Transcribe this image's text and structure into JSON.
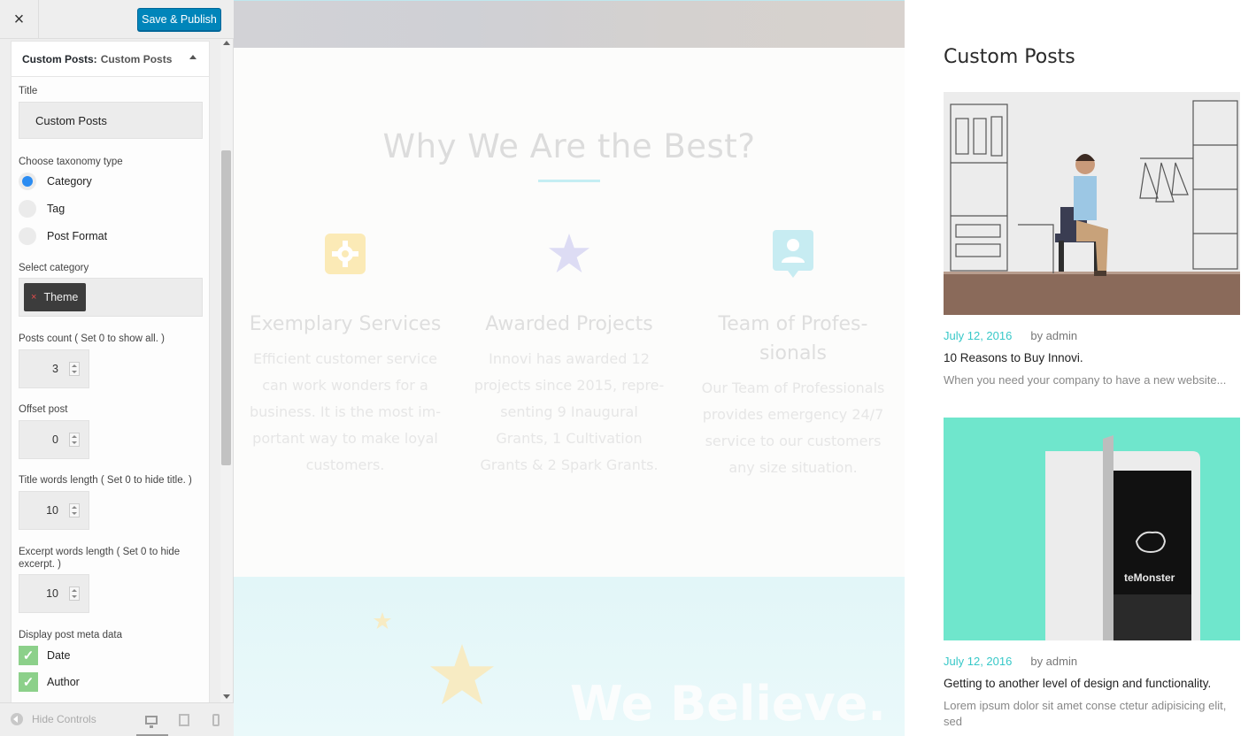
{
  "toolbar": {
    "close_label": "×",
    "save_label": "Save & Publish"
  },
  "widget": {
    "header_label": "Custom Posts:",
    "header_sub": "Custom Posts",
    "title_label": "Title",
    "title_value": "Custom Posts",
    "taxonomy_label": "Choose taxonomy type",
    "taxonomy_options": [
      "Category",
      "Tag",
      "Post Format"
    ],
    "taxonomy_selected": "Category",
    "category_label": "Select category",
    "category_chip": "Theme",
    "category_chip_remove": "×",
    "posts_count_label": "Posts count ( Set 0 to show all. )",
    "posts_count_value": "3",
    "offset_label": "Offset post",
    "offset_value": "0",
    "title_words_label": "Title words length ( Set 0 to hide title. )",
    "title_words_value": "10",
    "excerpt_words_label": "Excerpt words length ( Set 0 to hide excerpt. )",
    "excerpt_words_value": "10",
    "meta_label": "Display post meta data",
    "meta_options": [
      "Date",
      "Author"
    ],
    "meta_check_glyph": "✓"
  },
  "footer": {
    "hide_controls_label": "Hide Controls"
  },
  "preview": {
    "section_title": "Why We Are the Best?",
    "features": [
      {
        "title": "Exemplary Services",
        "text": "Efficient customer service can work wonders for a business. It is the most im-portant way to make loyal customers.",
        "icon": "gear-icon",
        "color": "#fbe9b4"
      },
      {
        "title": "Awarded Projects",
        "text": "Innovi has awarded 12 projects since 2015, repre-senting 9 Inaugural Grants, 1 Cultivation Grants & 2 Spark Grants.",
        "icon": "star-icon",
        "color": "#dcdcf4"
      },
      {
        "title": "Team of Profes-sionals",
        "text": "Our Team of Professionals provides emergency 24/7 service to our customers any size situation.",
        "icon": "user-icon",
        "color": "#c6ecf2"
      }
    ],
    "believe_text": "We Believe."
  },
  "sidebar": {
    "title": "Custom Posts",
    "posts": [
      {
        "date": "July 12, 2016",
        "author": "by admin",
        "title": "10 Reasons to Buy Innovi.",
        "excerpt": "When you need your company to have a new website..."
      },
      {
        "date": "July 12, 2016",
        "author": "by admin",
        "title": "Getting to another level of design and functionality.",
        "excerpt": "Lorem ipsum dolor sit amet conse ctetur adipisicing elit, sed"
      }
    ],
    "image2_brand": "teMonster"
  },
  "colors": {
    "accent": "#0085ba",
    "date": "#37c8c8",
    "checkbox": "#8cd08a",
    "radio": "#2b8cf2"
  }
}
